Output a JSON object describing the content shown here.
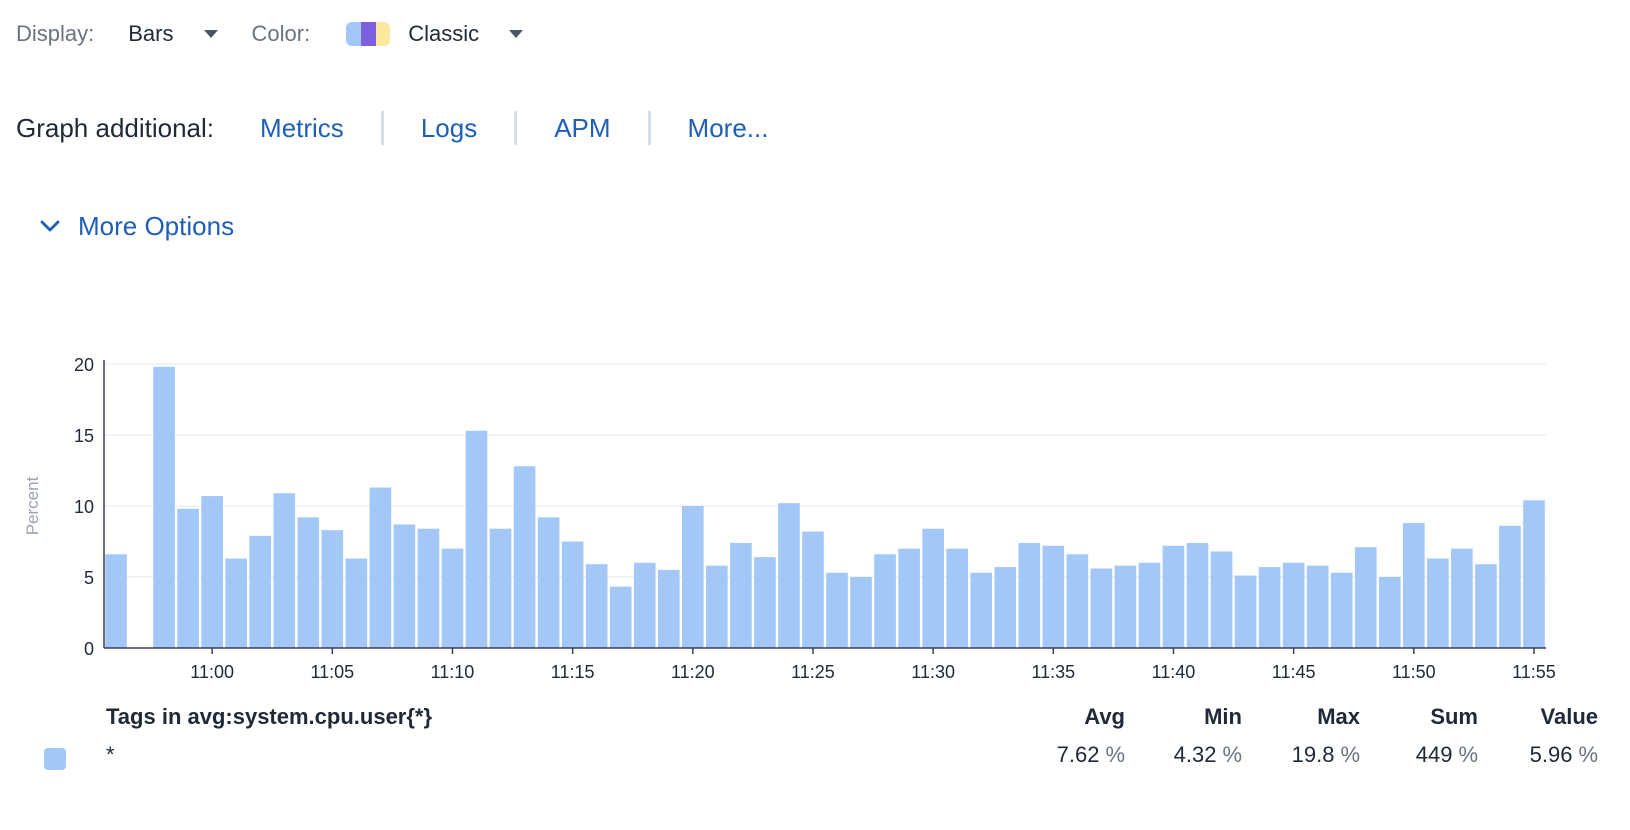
{
  "display": {
    "label": "Display:",
    "value": "Bars",
    "caret_icon": "caret-down-icon"
  },
  "color": {
    "label": "Color:",
    "value": "Classic",
    "swatch": [
      "#a3c8f8",
      "#7b5fdc",
      "#fde8a0"
    ],
    "caret_icon": "caret-down-icon"
  },
  "graph_additional": {
    "label": "Graph additional:",
    "links": [
      "Metrics",
      "Logs",
      "APM",
      "More..."
    ]
  },
  "more_options": {
    "label": "More Options",
    "icon": "chevron-down-icon"
  },
  "colors": {
    "bar": "#a3c8f8",
    "link": "#1f5fb8",
    "grid": "#e5e7eb",
    "axis": "#374151"
  },
  "chart_data": {
    "type": "bar",
    "ylabel": "Percent",
    "ylim": [
      0,
      20
    ],
    "yticks": [
      0,
      5,
      10,
      15,
      20
    ],
    "xlim": [
      "10:56",
      "11:55"
    ],
    "xticks": [
      "11:00",
      "11:05",
      "11:10",
      "11:15",
      "11:20",
      "11:25",
      "11:30",
      "11:35",
      "11:40",
      "11:45",
      "11:50",
      "11:55"
    ],
    "grid": true,
    "series": [
      {
        "name": "*",
        "x": [
          "10:56",
          "10:57",
          "10:58",
          "10:59",
          "11:00",
          "11:01",
          "11:02",
          "11:03",
          "11:04",
          "11:05",
          "11:06",
          "11:07",
          "11:08",
          "11:09",
          "11:10",
          "11:11",
          "11:12",
          "11:13",
          "11:14",
          "11:15",
          "11:16",
          "11:17",
          "11:18",
          "11:19",
          "11:20",
          "11:21",
          "11:22",
          "11:23",
          "11:24",
          "11:25",
          "11:26",
          "11:27",
          "11:28",
          "11:29",
          "11:30",
          "11:31",
          "11:32",
          "11:33",
          "11:34",
          "11:35",
          "11:36",
          "11:37",
          "11:38",
          "11:39",
          "11:40",
          "11:41",
          "11:42",
          "11:43",
          "11:44",
          "11:45",
          "11:46",
          "11:47",
          "11:48",
          "11:49",
          "11:50",
          "11:51",
          "11:52",
          "11:53",
          "11:54",
          "11:55"
        ],
        "values": [
          6.6,
          null,
          19.8,
          9.8,
          10.7,
          6.3,
          7.9,
          10.9,
          9.2,
          8.3,
          6.3,
          11.3,
          8.7,
          8.4,
          7.0,
          15.3,
          8.4,
          12.8,
          9.2,
          7.5,
          5.9,
          4.32,
          6.0,
          5.5,
          10.0,
          5.8,
          7.4,
          6.4,
          10.2,
          8.2,
          5.3,
          5.0,
          6.6,
          7.0,
          8.4,
          7.0,
          5.3,
          5.7,
          7.4,
          7.2,
          6.6,
          5.6,
          5.8,
          6.0,
          7.2,
          7.4,
          6.8,
          5.1,
          5.7,
          6.0,
          5.8,
          5.3,
          7.1,
          5.0,
          8.8,
          6.3,
          7.0,
          5.9,
          8.6,
          10.4
        ]
      }
    ]
  },
  "legend": {
    "tags_header": "Tags in avg:system.cpu.user{*}",
    "columns": [
      "Avg",
      "Min",
      "Max",
      "Sum",
      "Value"
    ],
    "rows": [
      {
        "tag": "*",
        "swatch_color": "#a3c8f8",
        "avg": "7.62",
        "min": "4.32",
        "max": "19.8",
        "sum": "449",
        "value": "5.96",
        "unit": "%"
      }
    ]
  }
}
